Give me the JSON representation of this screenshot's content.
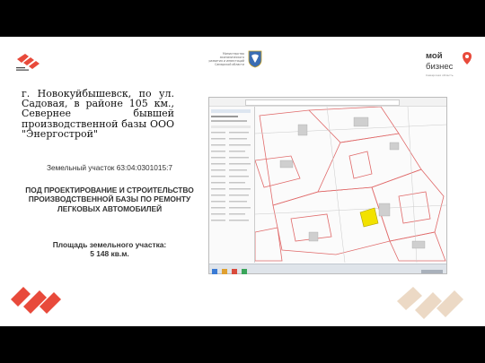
{
  "header": {
    "center_caption": "Министерство экономического развития и инвестиций Самарской области",
    "brand_word1": "мой",
    "brand_word2": "бизнес",
    "brand_caption": "Самарская область"
  },
  "address": {
    "text": "г. Новокуйбышевск, по ул. Садовая, в районе 105 км., Севернее бывшей производственной базы ООО \"Энергострой\""
  },
  "parcel": {
    "label": "Земельный участок 63:04:0301015:7"
  },
  "project": {
    "title": "ПОД ПРОЕКТИРОВАНИЕ И СТРОИТЕЛЬСТВО ПРОИЗВОДСТВЕННОЙ БАЗЫ ПО РЕМОНТУ ЛЕГКОВЫХ АВТОМОБИЛЕЙ"
  },
  "area": {
    "label": "Площадь земельного участка:",
    "value": "5 148 кв.м."
  },
  "colors": {
    "brand_red": "#e84a3b",
    "brand_beige": "#ecd9c5",
    "plot_yellow": "#f2e200"
  }
}
